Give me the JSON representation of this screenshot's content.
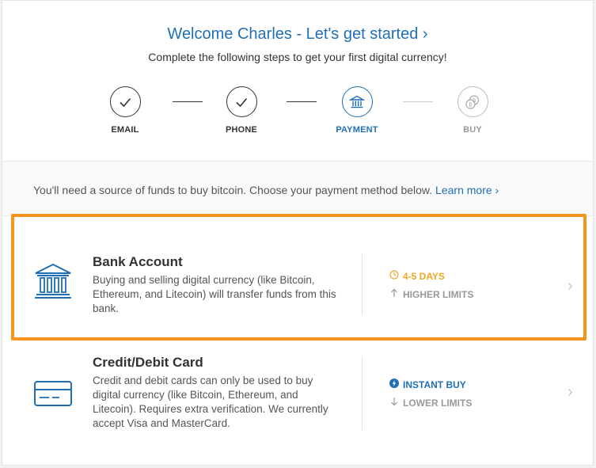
{
  "header": {
    "title": "Welcome Charles - Let's get started ›",
    "subtitle": "Complete the following steps to get your first digital currency!"
  },
  "steps": [
    {
      "label": "EMAIL",
      "status": "completed",
      "icon": "check-icon"
    },
    {
      "label": "PHONE",
      "status": "completed",
      "icon": "check-icon"
    },
    {
      "label": "PAYMENT",
      "status": "current",
      "icon": "bank-icon"
    },
    {
      "label": "BUY",
      "status": "pending",
      "icon": "coins-icon"
    }
  ],
  "info": {
    "text": "You'll need a source of funds to buy bitcoin. Choose your payment method below.",
    "link": "Learn more ›"
  },
  "methods": [
    {
      "title": "Bank Account",
      "description": "Buying and selling digital currency (like Bitcoin, Ethereum, and Litecoin) will transfer funds from this bank.",
      "badge1": "4-5 DAYS",
      "badge1_icon": "clock-icon",
      "badge2": "HIGHER LIMITS",
      "badge2_icon": "arrow-up-icon",
      "highlighted": true
    },
    {
      "title": "Credit/Debit Card",
      "description": "Credit and debit cards can only be used to buy digital currency (like Bitcoin, Ethereum, and Litecoin). Requires extra verification. We currently accept Visa and MasterCard.",
      "badge1": "INSTANT BUY",
      "badge1_icon": "lightning-icon",
      "badge2": "LOWER LIMITS",
      "badge2_icon": "arrow-down-icon",
      "highlighted": false
    }
  ],
  "colors": {
    "brand_blue": "#1f6fb5",
    "highlight_orange": "#f7941d",
    "days_orange": "#f0a623",
    "muted": "#999999"
  }
}
